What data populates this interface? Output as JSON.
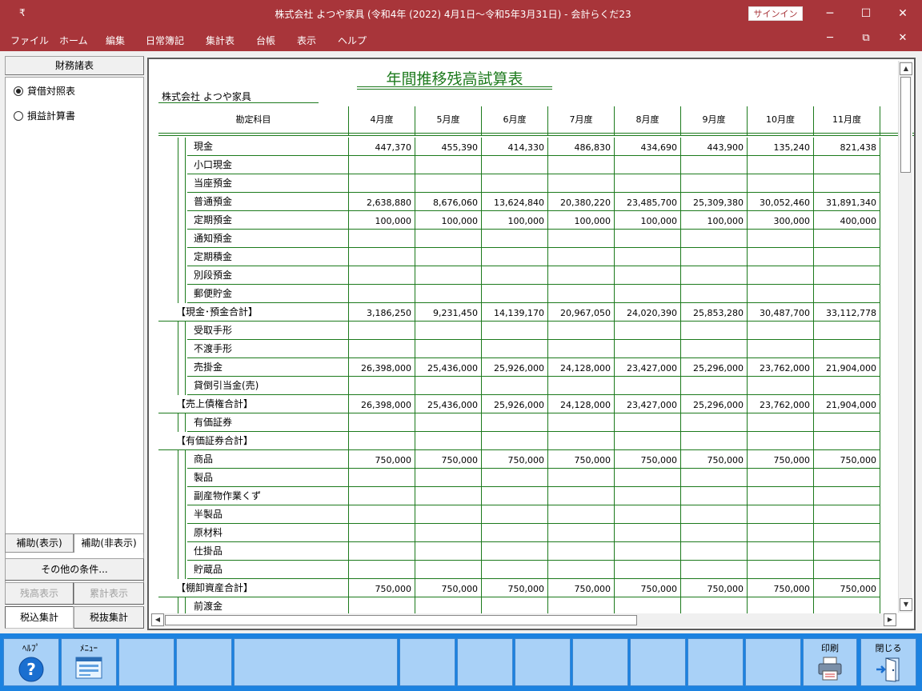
{
  "window": {
    "quick_access": "₹",
    "title": "株式会社  よつや家具 (令和4年 (2022) 4月1日～令和5年3月31日)  -  会計らくだ23",
    "signin": "サインイン",
    "minimize": "─",
    "maximize": "☐",
    "close": "✕"
  },
  "menu": {
    "items": [
      "ファイル",
      "ホーム",
      "編集",
      "日常簿記",
      "集計表",
      "台帳",
      "表示",
      "ヘルプ"
    ],
    "mdi_minimize": "─",
    "mdi_restore": "⧉",
    "mdi_close": "✕"
  },
  "left": {
    "header": "財務諸表",
    "options": [
      {
        "label": "貸借対照表",
        "selected": true
      },
      {
        "label": "損益計算書",
        "selected": false
      }
    ],
    "tabs": [
      "補助(表示)",
      "補助(非表示)"
    ],
    "other_conditions": "その他の条件...",
    "balance_display": "残高表示",
    "cumulative_display": "累計表示",
    "tax_incl": "税込集計",
    "tax_excl": "税抜集計"
  },
  "report": {
    "title": "年間推移残高試算表",
    "company": "株式会社  よつや家具",
    "col_account": "勘定科目",
    "months": [
      "4月度",
      "5月度",
      "6月度",
      "7月度",
      "8月度",
      "9月度",
      "10月度",
      "11月度"
    ],
    "rows": [
      {
        "name": "現金",
        "level": 2,
        "values": [
          "447,370",
          "455,390",
          "414,330",
          "486,830",
          "434,690",
          "443,900",
          "135,240",
          "821,438"
        ]
      },
      {
        "name": "小口現金",
        "level": 2,
        "values": [
          "",
          "",
          "",
          "",
          "",
          "",
          "",
          ""
        ]
      },
      {
        "name": "当座預金",
        "level": 2,
        "values": [
          "",
          "",
          "",
          "",
          "",
          "",
          "",
          ""
        ]
      },
      {
        "name": "普通預金",
        "level": 2,
        "values": [
          "2,638,880",
          "8,676,060",
          "13,624,840",
          "20,380,220",
          "23,485,700",
          "25,309,380",
          "30,052,460",
          "31,891,340"
        ]
      },
      {
        "name": "定期預金",
        "level": 2,
        "values": [
          "100,000",
          "100,000",
          "100,000",
          "100,000",
          "100,000",
          "100,000",
          "300,000",
          "400,000"
        ]
      },
      {
        "name": "通知預金",
        "level": 2,
        "values": [
          "",
          "",
          "",
          "",
          "",
          "",
          "",
          ""
        ]
      },
      {
        "name": "定期積金",
        "level": 2,
        "values": [
          "",
          "",
          "",
          "",
          "",
          "",
          "",
          ""
        ]
      },
      {
        "name": "別段預金",
        "level": 2,
        "values": [
          "",
          "",
          "",
          "",
          "",
          "",
          "",
          ""
        ]
      },
      {
        "name": "郵便貯金",
        "level": 2,
        "values": [
          "",
          "",
          "",
          "",
          "",
          "",
          "",
          ""
        ]
      },
      {
        "name": "【現金･預金合計】",
        "level": 1,
        "values": [
          "3,186,250",
          "9,231,450",
          "14,139,170",
          "20,967,050",
          "24,020,390",
          "25,853,280",
          "30,487,700",
          "33,112,778"
        ]
      },
      {
        "name": "受取手形",
        "level": 2,
        "values": [
          "",
          "",
          "",
          "",
          "",
          "",
          "",
          ""
        ]
      },
      {
        "name": "不渡手形",
        "level": 2,
        "values": [
          "",
          "",
          "",
          "",
          "",
          "",
          "",
          ""
        ]
      },
      {
        "name": "売掛金",
        "level": 2,
        "values": [
          "26,398,000",
          "25,436,000",
          "25,926,000",
          "24,128,000",
          "23,427,000",
          "25,296,000",
          "23,762,000",
          "21,904,000"
        ]
      },
      {
        "name": "貸倒引当金(売)",
        "level": 2,
        "values": [
          "",
          "",
          "",
          "",
          "",
          "",
          "",
          ""
        ]
      },
      {
        "name": "【売上債権合計】",
        "level": 1,
        "values": [
          "26,398,000",
          "25,436,000",
          "25,926,000",
          "24,128,000",
          "23,427,000",
          "25,296,000",
          "23,762,000",
          "21,904,000"
        ]
      },
      {
        "name": "有価証券",
        "level": 2,
        "values": [
          "",
          "",
          "",
          "",
          "",
          "",
          "",
          ""
        ]
      },
      {
        "name": "【有価証券合計】",
        "level": 1,
        "values": [
          "",
          "",
          "",
          "",
          "",
          "",
          "",
          ""
        ]
      },
      {
        "name": "商品",
        "level": 2,
        "values": [
          "750,000",
          "750,000",
          "750,000",
          "750,000",
          "750,000",
          "750,000",
          "750,000",
          "750,000"
        ]
      },
      {
        "name": "製品",
        "level": 2,
        "values": [
          "",
          "",
          "",
          "",
          "",
          "",
          "",
          ""
        ]
      },
      {
        "name": "副産物作業くず",
        "level": 2,
        "values": [
          "",
          "",
          "",
          "",
          "",
          "",
          "",
          ""
        ]
      },
      {
        "name": "半製品",
        "level": 2,
        "values": [
          "",
          "",
          "",
          "",
          "",
          "",
          "",
          ""
        ]
      },
      {
        "name": "原材料",
        "level": 2,
        "values": [
          "",
          "",
          "",
          "",
          "",
          "",
          "",
          ""
        ]
      },
      {
        "name": "仕掛品",
        "level": 2,
        "values": [
          "",
          "",
          "",
          "",
          "",
          "",
          "",
          ""
        ]
      },
      {
        "name": "貯蔵品",
        "level": 2,
        "values": [
          "",
          "",
          "",
          "",
          "",
          "",
          "",
          ""
        ]
      },
      {
        "name": "【棚卸資産合計】",
        "level": 1,
        "values": [
          "750,000",
          "750,000",
          "750,000",
          "750,000",
          "750,000",
          "750,000",
          "750,000",
          "750,000"
        ]
      },
      {
        "name": "前渡金",
        "level": 2,
        "values": [
          "",
          "",
          "",
          "",
          "",
          "",
          "",
          ""
        ]
      }
    ]
  },
  "toolbar": {
    "help": "ﾍﾙﾌﾟ",
    "menu": "ﾒﾆｭｰ",
    "print": "印刷",
    "close": "閉じる"
  }
}
